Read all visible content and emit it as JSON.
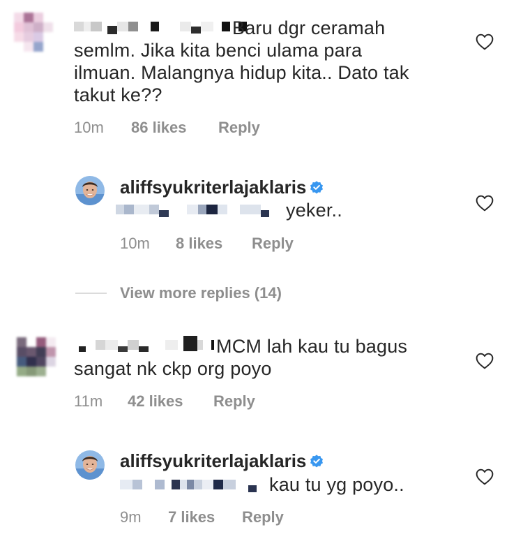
{
  "comments": [
    {
      "text": "Baru dgr ceramah semlm. Jika kita benci ulama para ilmuan. Malangnya hidup kita.. Dato tak takut ke??",
      "lines": [
        "Baru dgr ceramah",
        "semlm. Jika kita benci ulama para",
        "ilmuan. Malangnya hidup kita.. Dato tak",
        "takut ke??"
      ],
      "time": "10m",
      "likes": "86 likes",
      "reply_label": "Reply",
      "replies": [
        {
          "username": "aliffsyukriterlajaklaris",
          "text": "yeker..",
          "time": "10m",
          "likes": "8 likes",
          "reply_label": "Reply"
        }
      ],
      "view_more": "View more replies (14)"
    },
    {
      "text": "MCM lah kau tu bagus sangat nk ckp org poyo",
      "lines": [
        "MCM lah kau tu bagus",
        "sangat nk ckp org poyo"
      ],
      "time": "11m",
      "likes": "42 likes",
      "reply_label": "Reply",
      "replies": [
        {
          "username": "aliffsyukriterlajaklaris",
          "text": "kau tu yg poyo..",
          "time": "9m",
          "likes": "7 likes",
          "reply_label": "Reply"
        }
      ]
    }
  ],
  "icons": {
    "like": "heart-outline-icon",
    "verified": "verified-badge-icon"
  },
  "colors": {
    "text": "#262626",
    "meta": "#8e8e8e",
    "verified": "#3897f0",
    "divider": "#dbdbdb"
  }
}
